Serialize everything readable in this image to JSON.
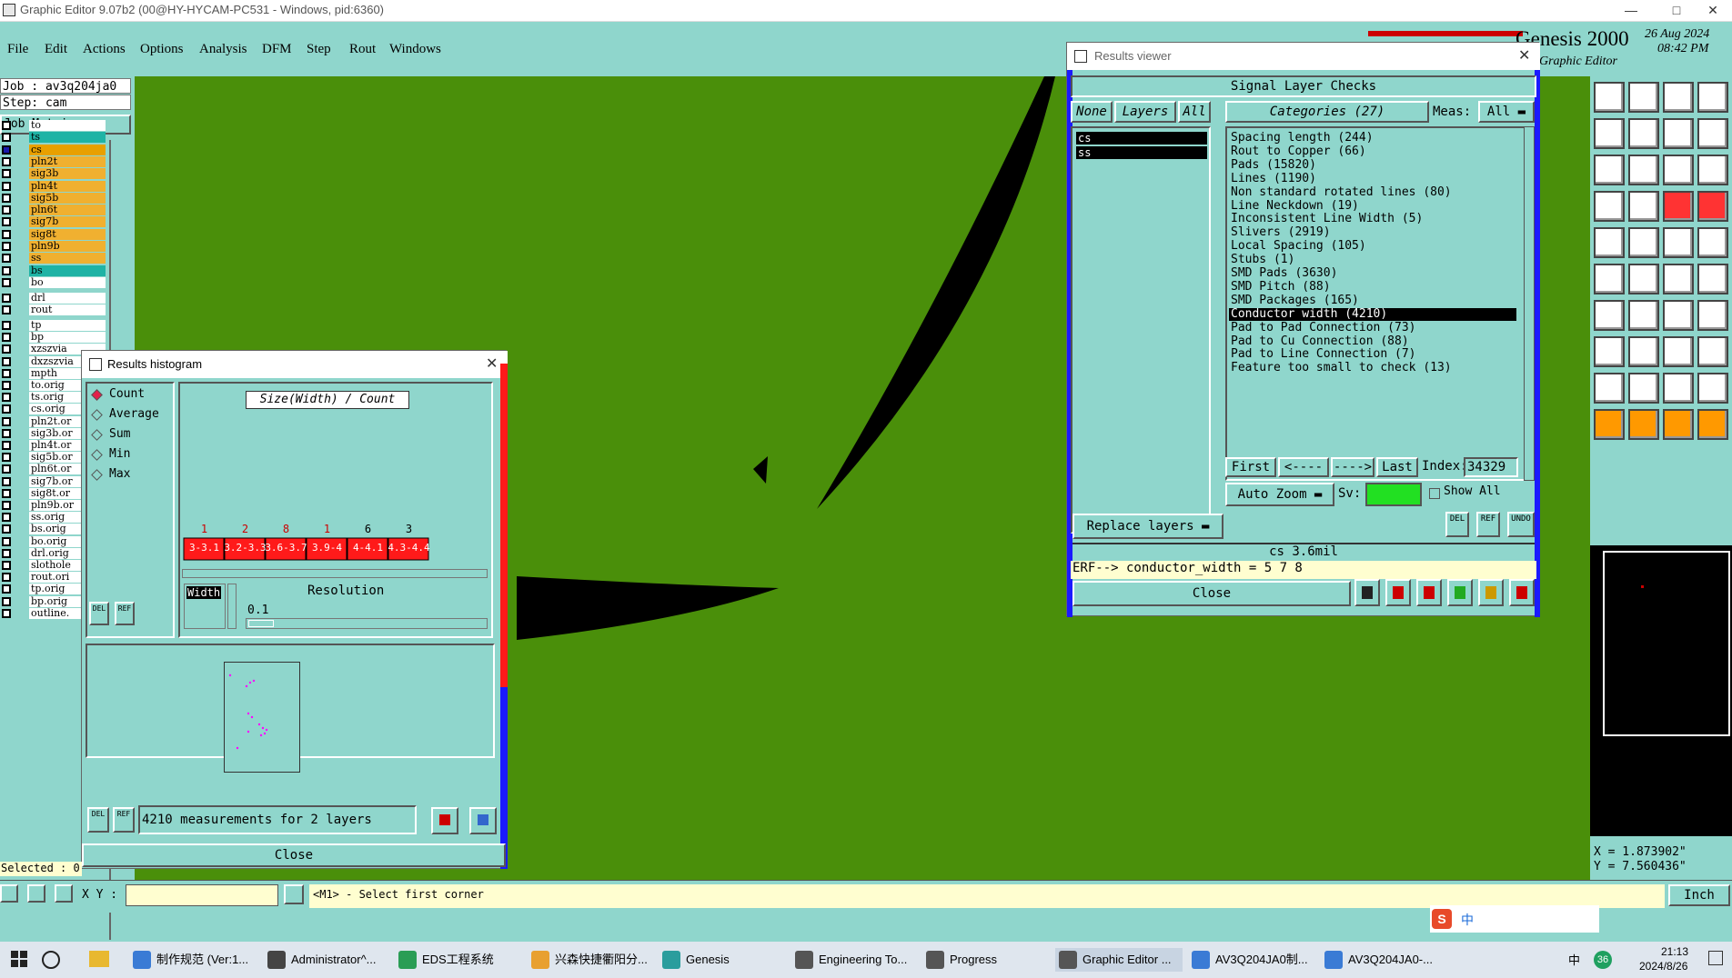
{
  "window": {
    "title": "Graphic Editor 9.07b2 (00@HY-HYCAM-PC531 - Windows, pid:6360)"
  },
  "menu": [
    "File",
    "Edit",
    "Actions",
    "Options",
    "Analysis",
    "DFM",
    "Step",
    "Rout",
    "Windows"
  ],
  "brand": {
    "name": "Genesis 2000",
    "sub": "Graphic Editor",
    "date": "26 Aug 2024",
    "time": "08:42 PM"
  },
  "job": {
    "job": "Job : av3q204ja0",
    "step": "Step: cam",
    "matrix_btn": "Job Matrix ..."
  },
  "layers_top": [
    {
      "name": "to",
      "color": "#ffffff"
    },
    {
      "name": "ts",
      "color": "#1fb3a5"
    },
    {
      "name": "cs",
      "color": "#e8a000"
    },
    {
      "name": "pln2t",
      "color": "#f0b030"
    },
    {
      "name": "sig3b",
      "color": "#f0b030"
    },
    {
      "name": "pln4t",
      "color": "#f0b030"
    },
    {
      "name": "sig5b",
      "color": "#f0b030"
    },
    {
      "name": "pln6t",
      "color": "#f0b030"
    },
    {
      "name": "sig7b",
      "color": "#f0b030"
    },
    {
      "name": "sig8t",
      "color": "#f0b030"
    },
    {
      "name": "pln9b",
      "color": "#f0b030"
    },
    {
      "name": "ss",
      "color": "#f0b030"
    },
    {
      "name": "bs",
      "color": "#1fb3a5"
    },
    {
      "name": "bo",
      "color": "#ffffff"
    }
  ],
  "layers_mid": [
    {
      "name": "drl"
    },
    {
      "name": "rout"
    }
  ],
  "layers_bottom": [
    "tp",
    "bp",
    "xzszvia",
    "dxzszvia",
    "mpth",
    "to.orig",
    "ts.orig",
    "cs.orig",
    "pln2t.or",
    "sig3b.or",
    "pln4t.or",
    "sig5b.or",
    "pln6t.or",
    "sig7b.or",
    "sig8t.or",
    "pln9b.or",
    "ss.orig",
    "bs.orig",
    "bo.orig",
    "drl.orig",
    "slothole",
    "rout.ori",
    "tp.orig",
    "bp.orig",
    "outline."
  ],
  "selected": "Selected : 0",
  "results_viewer": {
    "title": "Results viewer",
    "heading": "Signal Layer Checks",
    "none_btn": "None",
    "layers_btn": "Layers",
    "all_btn": "All",
    "categories_btn": "Categories (27)",
    "meas_label": "Meas:",
    "meas_value": "All",
    "layers": [
      "cs",
      "ss"
    ],
    "categories": [
      "Spacing length (244)",
      "Rout to Copper (66)",
      "Pads (15820)",
      "Lines (1190)",
      "Non standard rotated lines (80)",
      "Line Neckdown (19)",
      "Inconsistent Line Width (5)",
      "Slivers (2919)",
      "Local Spacing (105)",
      "Stubs (1)",
      "SMD Pads (3630)",
      "SMD Pitch (88)",
      "SMD Packages (165)",
      "Conductor width (4210)",
      "Pad to Pad Connection (73)",
      "Pad to Cu Connection (88)",
      "Pad to Line Connection (7)",
      "Feature too small to check (13)"
    ],
    "selected_category": 13,
    "first_btn": "First",
    "prev_btn": "<----",
    "next_btn": "---->",
    "last_btn": "Last",
    "index_label": "Index:",
    "index_value": "34329",
    "auto_zoom": "Auto Zoom",
    "sv_label": "Sv:",
    "show_all": "Show All",
    "replace_layers": "Replace layers",
    "del": "DEL",
    "ref": "REF",
    "undo": "UNDO",
    "status": "cs 3.6mil",
    "erf": "ERF--> conductor_width = 5 7 8",
    "close_btn": "Close"
  },
  "histogram": {
    "title": "Results histogram",
    "options": [
      "Count",
      "Average",
      "Sum",
      "Min",
      "Max"
    ],
    "selected_option": 0,
    "chart_title": "Size(Width) / Count",
    "counts": [
      "1",
      "2",
      "8",
      "1",
      "6",
      "3"
    ],
    "bins": [
      "3-3.1",
      "3.2-3.3",
      "3.6-3.7",
      "3.9-4",
      "4-4.1",
      "4.3-4.4"
    ],
    "width_label": "Width",
    "resolution_label": "Resolution",
    "resolution_value": "0.1",
    "del": "DEL",
    "ref": "REF",
    "measurements": "4210 measurements for 2 layers",
    "close_btn": "Close"
  },
  "cmd": {
    "xy_label": "X Y :",
    "prompt": "<M1> - Select first corner",
    "unit": "Inch"
  },
  "coords": {
    "x": "X = 1.873902\"",
    "y": "Y = 7.560436\""
  },
  "taskbar": {
    "items": [
      "制作规范 (Ver:1...",
      "Administrator^...",
      "EDS工程系统",
      "兴森快捷衢阳分...",
      "Genesis",
      "Engineering To...",
      "Progress",
      "Graphic Editor ...",
      "AV3Q204JA0制...",
      "AV3Q204JA0-..."
    ],
    "ime": "中",
    "badge": "36",
    "time": "21:13",
    "date": "2024/8/26"
  },
  "colors": {
    "canvas": "#4a8f0a",
    "panel": "#8fd6cc",
    "bar": "#ff1a1a"
  }
}
